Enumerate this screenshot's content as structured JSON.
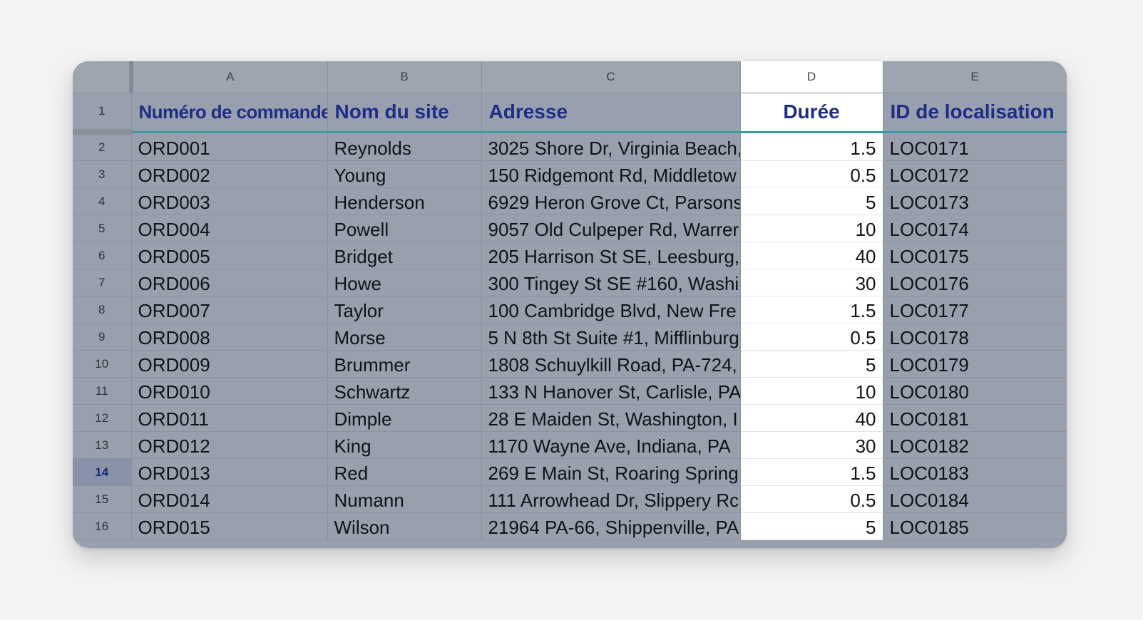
{
  "columns": [
    "A",
    "B",
    "C",
    "D",
    "E"
  ],
  "header": {
    "row_number": "1",
    "cells": [
      "Numéro de commande",
      "Nom du site",
      "Adresse",
      "Durée",
      "ID de localisation"
    ]
  },
  "rows": [
    {
      "n": "2",
      "order": "ORD001",
      "site": "Reynolds",
      "address": "3025 Shore Dr, Virginia Beach,",
      "duration": "1.5",
      "location": "LOC0171"
    },
    {
      "n": "3",
      "order": "ORD002",
      "site": "Young",
      "address": "150 Ridgemont Rd, Middletow",
      "duration": "0.5",
      "location": "LOC0172"
    },
    {
      "n": "4",
      "order": "ORD003",
      "site": "Henderson",
      "address": "6929 Heron Grove Ct, Parsons",
      "duration": "5",
      "location": "LOC0173"
    },
    {
      "n": "5",
      "order": "ORD004",
      "site": "Powell",
      "address": "9057 Old Culpeper Rd, Warrer",
      "duration": "10",
      "location": "LOC0174"
    },
    {
      "n": "6",
      "order": "ORD005",
      "site": "Bridget",
      "address": "205 Harrison St SE, Leesburg,",
      "duration": "40",
      "location": "LOC0175"
    },
    {
      "n": "7",
      "order": "ORD006",
      "site": "Howe",
      "address": "300 Tingey St SE #160, Washi",
      "duration": "30",
      "location": "LOC0176"
    },
    {
      "n": "8",
      "order": "ORD007",
      "site": "Taylor",
      "address": "100 Cambridge Blvd, New Fre",
      "duration": "1.5",
      "location": "LOC0177"
    },
    {
      "n": "9",
      "order": "ORD008",
      "site": "Morse",
      "address": "5 N 8th St Suite #1, Mifflinburg",
      "duration": "0.5",
      "location": "LOC0178"
    },
    {
      "n": "10",
      "order": "ORD009",
      "site": "Brummer",
      "address": "1808 Schuylkill Road, PA-724,",
      "duration": "5",
      "location": "LOC0179"
    },
    {
      "n": "11",
      "order": "ORD010",
      "site": "Schwartz",
      "address": "133 N Hanover St, Carlisle, PA",
      "duration": "10",
      "location": "LOC0180"
    },
    {
      "n": "12",
      "order": "ORD011",
      "site": "Dimple",
      "address": "28 E Maiden St, Washington, I",
      "duration": "40",
      "location": "LOC0181"
    },
    {
      "n": "13",
      "order": "ORD012",
      "site": "King",
      "address": "1170 Wayne Ave, Indiana, PA",
      "duration": "30",
      "location": "LOC0182"
    },
    {
      "n": "14",
      "order": "ORD013",
      "site": "Red",
      "address": "269 E Main St, Roaring Spring",
      "duration": "1.5",
      "location": "LOC0183",
      "active": true
    },
    {
      "n": "15",
      "order": "ORD014",
      "site": "Numann",
      "address": "111 Arrowhead Dr, Slippery Rc",
      "duration": "0.5",
      "location": "LOC0184"
    },
    {
      "n": "16",
      "order": "ORD015",
      "site": "Wilson",
      "address": "21964 PA-66, Shippenville, PA",
      "duration": "5",
      "location": "LOC0185"
    }
  ],
  "selected_column": "D",
  "colors": {
    "header_text": "#1f2d86",
    "overlay": "#99a0ad",
    "selected_column_bg": "#ffffff",
    "active_row_header": "#8992a8"
  }
}
